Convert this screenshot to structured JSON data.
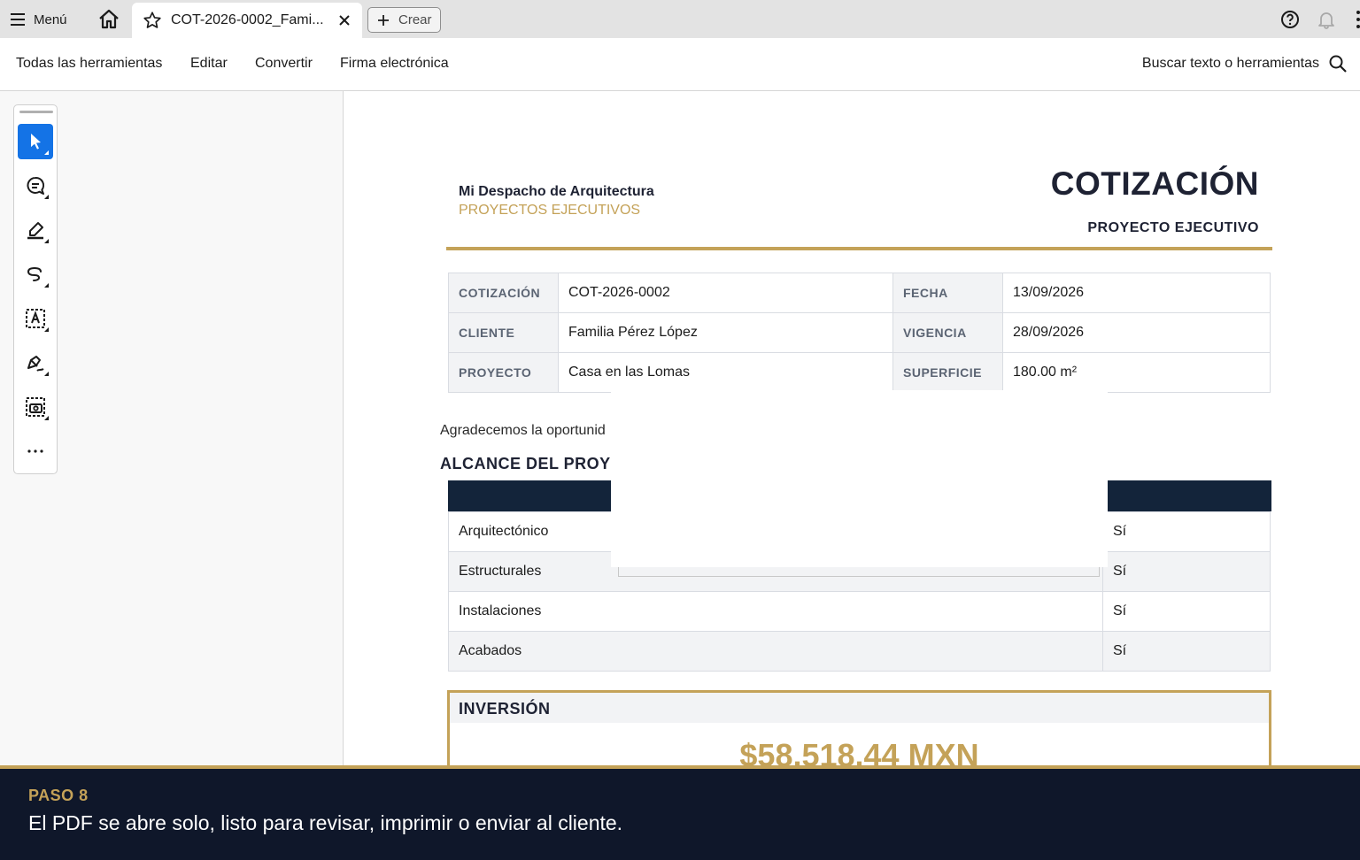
{
  "tabbar": {
    "menu_label": "Menú",
    "tab_title": "COT-2026-0002_Fami...",
    "create_label": "Crear"
  },
  "toolnav": {
    "items": [
      "Todas las herramientas",
      "Editar",
      "Convertir",
      "Firma electrónica"
    ],
    "search_label": "Buscar texto o herramientas"
  },
  "quick_tools": [
    "select-icon",
    "comment-icon",
    "highlight-icon",
    "draw-icon",
    "text-box-icon",
    "sign-icon",
    "screenshot-icon",
    "more-icon"
  ],
  "document": {
    "firm_name": "Mi Despacho de Arquitectura",
    "firm_subtitle": "PROYECTOS EJECUTIVOS",
    "title": "COTIZACIÓN",
    "subtitle": "PROYECTO EJECUTIVO",
    "info": {
      "rows": [
        {
          "l1": "COTIZACIÓN",
          "v1": "COT-2026-0002",
          "l2": "FECHA",
          "v2": "13/09/2026"
        },
        {
          "l1": "CLIENTE",
          "v1": "Familia Pérez López",
          "l2": "VIGENCIA",
          "v2": "28/09/2026"
        },
        {
          "l1": "PROYECTO",
          "v1": "Casa en las Lomas",
          "l2": "SUPERFICIE",
          "v2": "180.00 m²"
        }
      ]
    },
    "intro": "Agradecemos la oportunid",
    "scope_title": "ALCANCE DEL PROY",
    "scope_rows": [
      {
        "item": "Arquitectónico",
        "included": "Sí"
      },
      {
        "item": "Estructurales",
        "included": "Sí"
      },
      {
        "item": "Instalaciones",
        "included": "Sí"
      },
      {
        "item": "Acabados",
        "included": "Sí"
      }
    ],
    "investment_title": "INVERSIÓN",
    "investment_amount": "$58,518.44 MXN"
  },
  "caption": {
    "step": "PASO 8",
    "text": "El PDF se abre solo, listo para revisar, imprimir o enviar al cliente."
  },
  "colors": {
    "accent_gold": "#c4a258",
    "navy": "#13243a",
    "caption_bg": "#0f172a",
    "active_tool": "#1473e6"
  }
}
